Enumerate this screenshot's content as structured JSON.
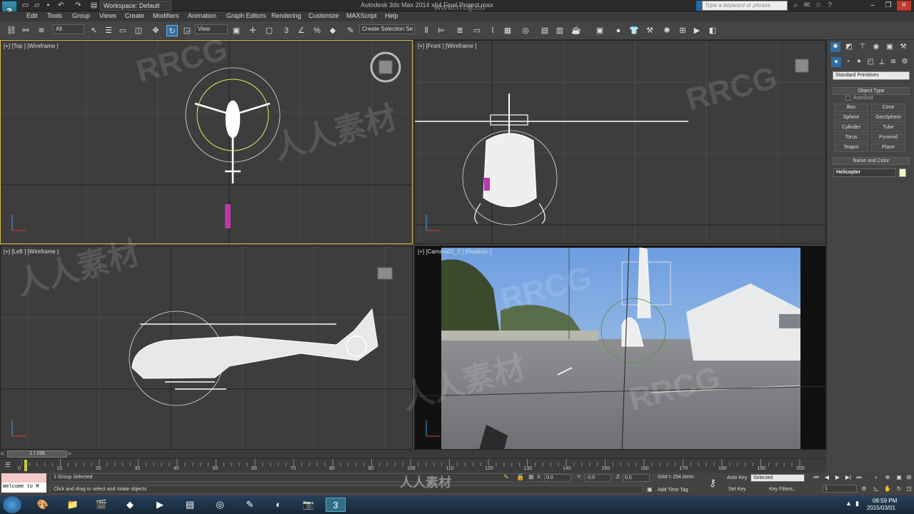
{
  "app": {
    "title": "Autodesk 3ds Max  2014 x64    Final Project.max",
    "logo_glyph": "3",
    "workspace": "Workspace: Default",
    "search_placeholder": "Type a keyword or phrase"
  },
  "menu": [
    "Edit",
    "Tools",
    "Group",
    "Views",
    "Create",
    "Modifiers",
    "Animation",
    "Graph Editors",
    "Rendering",
    "Customize",
    "MAXScript",
    "Help"
  ],
  "toolbar": {
    "selection_filter": "All",
    "ref_coord": "View",
    "named_selection": "Create Selection Se"
  },
  "viewports": {
    "top": {
      "label": "[+] [Top ] [Wireframe ]"
    },
    "front": {
      "label": "[+] [Front ] [Wireframe ]"
    },
    "left": {
      "label": "[+] [Left ] [Wireframe ]"
    },
    "camera": {
      "label": "[+] [Camera01_2 ] [Realistic ]"
    }
  },
  "command_panel": {
    "dropdown": "Standard Primitives",
    "object_type_title": "Object Type",
    "autogrid": "AutoGrid",
    "primitives": [
      "Box",
      "Cone",
      "Sphere",
      "GeoSphere",
      "Cylinder",
      "Tube",
      "Torus",
      "Pyramid",
      "Teapot",
      "Plane"
    ],
    "name_color_title": "Name and Color",
    "object_name": "Helicopter",
    "object_color": "#f5f5c8"
  },
  "timeline": {
    "frame_display": "1 / 199",
    "current_frame": 1,
    "total_frames": 199,
    "ticks": [
      "0",
      "10",
      "20",
      "30",
      "40",
      "50",
      "60",
      "70",
      "80",
      "90",
      "100",
      "110",
      "120",
      "130",
      "140",
      "150",
      "160",
      "170",
      "180",
      "190",
      "200"
    ]
  },
  "status": {
    "maxscript_text": "Welcome to M",
    "selection_info": "1 Group Selected",
    "prompt": "Click and drag to select and rotate objects",
    "x_label": "X:",
    "x_value": "0.0",
    "y_label": "Y:",
    "y_value": "-0.0",
    "z_label": "Z:",
    "z_value": "0.0",
    "grid": "Grid = 254.0mm",
    "add_time_tag": "Add Time Tag",
    "auto_key": "Auto Key",
    "selected": "Selected",
    "set_key": "Set Key",
    "key_filters": "Key Filters...",
    "frame_field": "1"
  },
  "taskbar": {
    "time": "08:59 PM",
    "date": "2015/03/01"
  },
  "watermark": {
    "latin": "RRCG",
    "chinese": "人人素材",
    "url": "www.rrcg.cn"
  }
}
